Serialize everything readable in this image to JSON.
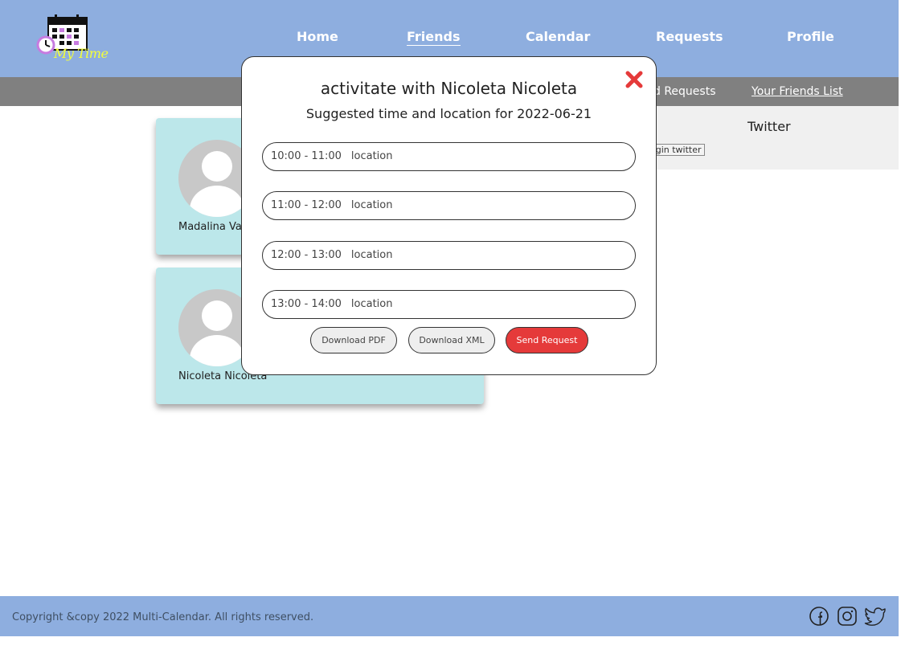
{
  "header": {
    "logo_text": "My Time",
    "nav": [
      {
        "label": "Home",
        "active": false
      },
      {
        "label": "Friends",
        "active": true
      },
      {
        "label": "Calendar",
        "active": false
      },
      {
        "label": "Requests",
        "active": false
      },
      {
        "label": "Profile",
        "active": false
      }
    ]
  },
  "subnav": {
    "friend_requests_partial": "d Requests",
    "friends_list": "Your Friends List"
  },
  "social_panel": {
    "title": "Twitter",
    "login_button": "ogin twitter"
  },
  "friends": [
    {
      "name": "Madalina Va"
    },
    {
      "name": "Nicoleta Nicoleta"
    }
  ],
  "modal": {
    "title": "activitate with Nicoleta Nicoleta",
    "subtitle": "Suggested time and location for 2022-06-21",
    "slots": [
      {
        "time": "10:00 - 11:00",
        "location": "location"
      },
      {
        "time": "11:00 - 12:00",
        "location": "location"
      },
      {
        "time": "12:00 - 13:00",
        "location": "location"
      },
      {
        "time": "13:00 - 14:00",
        "location": "location"
      }
    ],
    "buttons": {
      "download_pdf": "Download PDF",
      "download_xml": "Download XML",
      "send_request": "Send Request"
    }
  },
  "footer": {
    "copyright": "Copyright &copy 2022 Multi-Calendar. All rights reserved.",
    "icons": [
      "facebook-icon",
      "instagram-icon",
      "twitter-icon"
    ]
  },
  "colors": {
    "header_bg": "#8eaedf",
    "subbar_bg": "#808080",
    "card_bg": "#bce7ea",
    "accent_red": "#e53a3a",
    "logo_yellow": "#f4ff3a"
  }
}
